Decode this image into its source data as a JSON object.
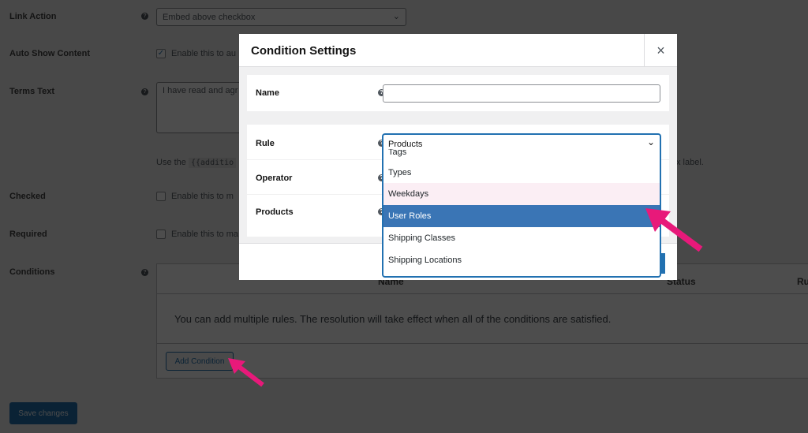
{
  "settings": {
    "link_action": {
      "label": "Link Action",
      "value": "Embed above checkbox"
    },
    "auto_show": {
      "label": "Auto Show Content",
      "text": "Enable this to au",
      "checked": true
    },
    "terms": {
      "label": "Terms Text",
      "value": "I have read and agr",
      "hint_prefix": "Use the",
      "hint_code": "{{additio",
      "hint_suffix": "x label."
    },
    "checked": {
      "label": "Checked",
      "text": "Enable this to m"
    },
    "required": {
      "label": "Required",
      "text": "Enable this to ma"
    },
    "conditions": {
      "label": "Conditions",
      "columns": [
        "Name",
        "Status",
        "Ru"
      ],
      "empty_message": "You can add multiple rules. The resolution will take effect when all of the conditions are satisfied.",
      "add_button": "Add Condition"
    },
    "save_button": "Save changes"
  },
  "modal": {
    "title": "Condition Settings",
    "close": "×",
    "name_label": "Name",
    "name_value": "",
    "rule_label": "Rule",
    "rule_value": "Products",
    "operator_label": "Operator",
    "products_label": "Products",
    "options": [
      "Tags",
      "Types",
      "Weekdays",
      "User Roles",
      "Shipping Classes",
      "Shipping Locations"
    ],
    "selected_option": "User Roles",
    "hovered_option": "Weekdays"
  },
  "colors": {
    "accent": "#2271b1",
    "selected": "#3a75b5",
    "arrow": "#e8197a"
  }
}
